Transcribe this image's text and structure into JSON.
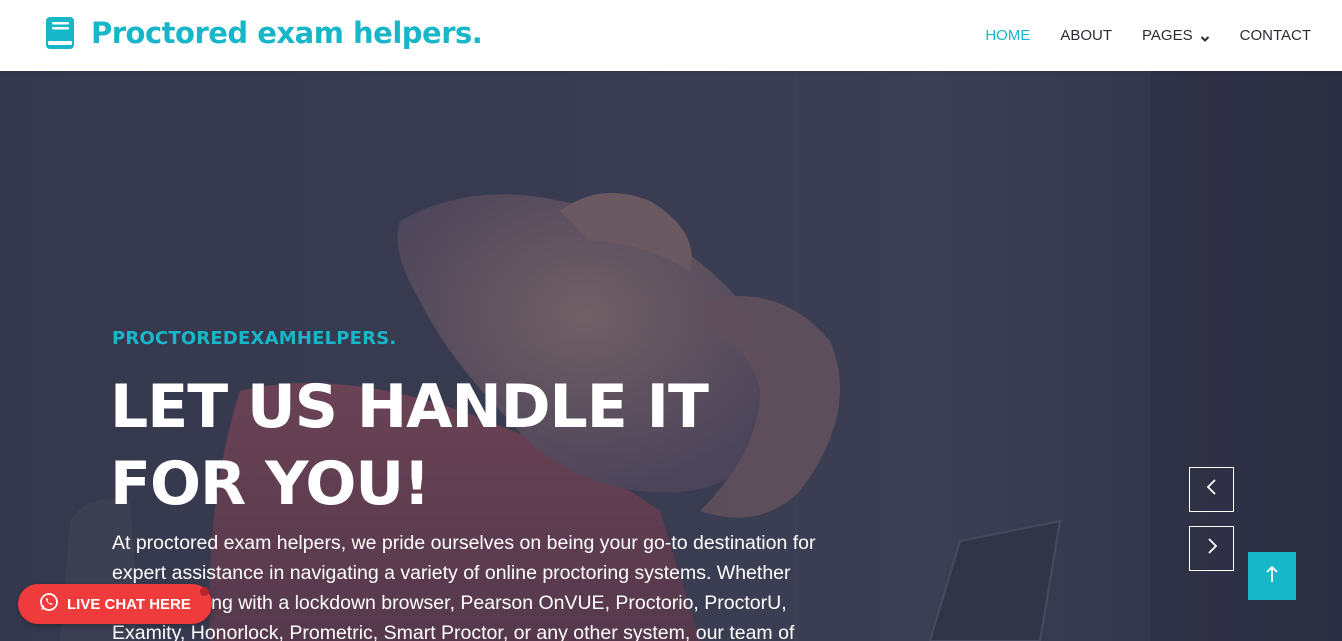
{
  "brand": {
    "icon": "book-icon",
    "name": "Proctored exam helpers."
  },
  "nav": {
    "items": [
      {
        "label": "HOME",
        "active": true
      },
      {
        "label": "ABOUT",
        "active": false
      },
      {
        "label": "PAGES",
        "active": false,
        "icon": "chevron-down-icon"
      },
      {
        "label": "CONTACT",
        "active": false
      }
    ]
  },
  "hero": {
    "eyebrow": "PROCTOREDEXAMHELPERS.",
    "headline_line1": "LET US HANDLE IT",
    "headline_line2": "FOR YOU!",
    "body_line1": "At proctored exam helpers, we pride ourselves on being your go-to destination for",
    "body_line2": "expert assistance in navigating a variety of online proctoring systems. Whether",
    "body_line3": "you're dealing with a lockdown browser, Pearson OnVUE, Proctorio, ProctorU,",
    "body_line4": "Examity, Honorlock, Prometric, Smart Proctor, or any other system, our team of"
  },
  "controls": {
    "prev_icon": "chevron-left-icon",
    "next_icon": "chevron-right-icon",
    "top_icon": "arrow-up-icon"
  },
  "live_chat": {
    "icon": "whatsapp-icon",
    "label": "LIVE CHAT HERE"
  },
  "colors": {
    "accent": "#17b6c9",
    "chat": "#ef3b3b",
    "overlay": "#3c3f55"
  }
}
